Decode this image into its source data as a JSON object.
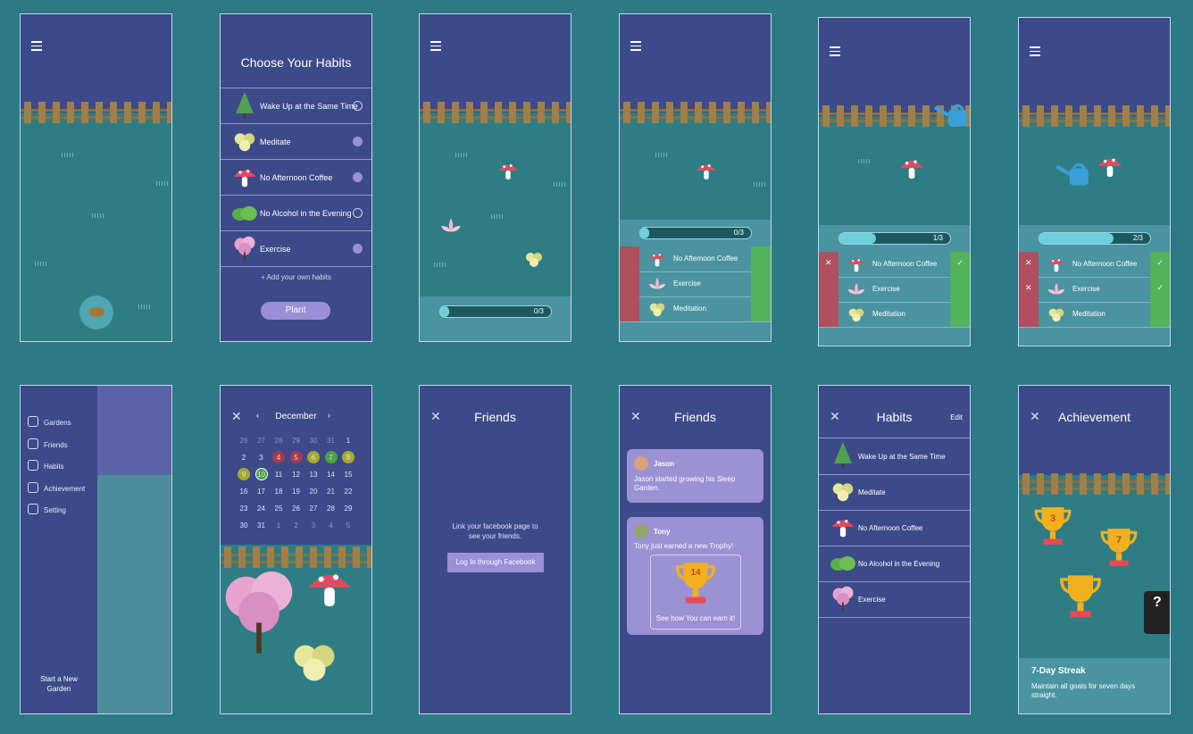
{
  "colors": {
    "background": "#2b7a86",
    "navy": "#3c4a8a",
    "garden": "#2e7d85",
    "accent": "#9c8fd6",
    "check": "#53b35b",
    "cross": "#b04f5e"
  },
  "choose": {
    "title": "Choose Your Habits",
    "habits": [
      {
        "label": "Wake Up at the Same Time",
        "icon": "tree-icon",
        "checked": false
      },
      {
        "label": "Meditate",
        "icon": "flower-cluster-icon",
        "checked": true
      },
      {
        "label": "No Afternoon Coffee",
        "icon": "mushroom-icon",
        "checked": true
      },
      {
        "label": "No Alcohol in the Evening",
        "icon": "bush-icon",
        "checked": false
      },
      {
        "label": "Exercise",
        "icon": "blossom-tree-icon",
        "checked": true
      }
    ],
    "add_label": "Add your own habits",
    "plant_label": "Plant"
  },
  "progress": {
    "zero": "0/3",
    "one": "1/3",
    "two": "2/3",
    "fill_zero": 0.0,
    "fill_one": 0.33,
    "fill_two": 0.67
  },
  "tracker": {
    "items": [
      "No Afternoon Coffee",
      "Exercise",
      "Meditation"
    ]
  },
  "menu": {
    "items": [
      "Gardens",
      "Friends",
      "Habits",
      "Achievement",
      "Setting"
    ],
    "new_garden": "Start a New Garden"
  },
  "calendar": {
    "month": "December",
    "rows": [
      [
        "26",
        "27",
        "28",
        "29",
        "30",
        "31",
        "1"
      ],
      [
        "2",
        "3",
        "4",
        "5",
        "6",
        "7",
        "8"
      ],
      [
        "9",
        "10",
        "11",
        "12",
        "13",
        "14",
        "15"
      ],
      [
        "16",
        "17",
        "18",
        "19",
        "20",
        "21",
        "22"
      ],
      [
        "23",
        "24",
        "25",
        "26",
        "27",
        "28",
        "29"
      ],
      [
        "30",
        "31",
        "1",
        "2",
        "3",
        "4",
        "5"
      ]
    ]
  },
  "friends": {
    "title": "Friends",
    "empty_text": "Link your facebook page to see your friends.",
    "fb_button": "Log In through Facebook",
    "feed": [
      {
        "name": "Jason",
        "text": "Jason started growing his Sleep Garden."
      },
      {
        "name": "Tony",
        "text": "Tony just earned a new Trophy!",
        "trophy_number": "14",
        "cta": "See how You can earn it!"
      }
    ]
  },
  "habits_list": {
    "title": "Habits",
    "edit_label": "Edit",
    "items": [
      "Wake Up at the Same Time",
      "Meditate",
      "No Afternoon Coffee",
      "No Alcohol in the Evening",
      "Exercise"
    ]
  },
  "achievement": {
    "title": "Achievement",
    "trophies": [
      "3",
      "7",
      "",
      "?"
    ],
    "streak_title": "7-Day Streak",
    "streak_text": "Maintain all goals for seven days straight."
  }
}
